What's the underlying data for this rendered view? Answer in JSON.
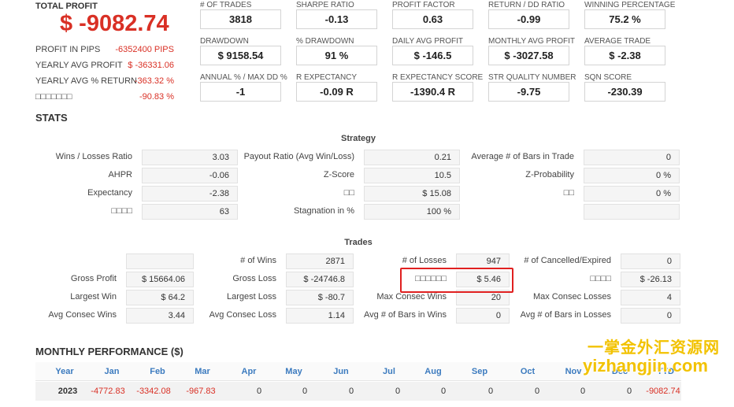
{
  "summary": {
    "total_profit_label": "TOTAL PROFIT",
    "total_profit_value": "$ -9082.74",
    "rows": [
      {
        "label": "PROFIT IN PIPS",
        "value": "-6352400 PIPS"
      },
      {
        "label": "YEARLY AVG PROFIT",
        "value": "$ -36331.06"
      },
      {
        "label": "YEARLY AVG % RETURN",
        "value": "-363.32 %"
      },
      {
        "label": "□□□□□□□",
        "value": "-90.83 %"
      }
    ]
  },
  "metrics": [
    {
      "label": "# OF TRADES",
      "value": "3818"
    },
    {
      "label": "SHARPE RATIO",
      "value": "-0.13"
    },
    {
      "label": "PROFIT FACTOR",
      "value": "0.63"
    },
    {
      "label": "RETURN / DD RATIO",
      "value": "-0.99"
    },
    {
      "label": "WINNING PERCENTAGE",
      "value": "75.2 %"
    },
    {
      "label": "DRAWDOWN",
      "value": "$ 9158.54"
    },
    {
      "label": "% DRAWDOWN",
      "value": "91 %"
    },
    {
      "label": "DAILY AVG PROFIT",
      "value": "$ -146.5"
    },
    {
      "label": "MONTHLY AVG PROFIT",
      "value": "$ -3027.58"
    },
    {
      "label": "AVERAGE TRADE",
      "value": "$ -2.38"
    },
    {
      "label": "ANNUAL % / MAX DD %",
      "value": "-1"
    },
    {
      "label": "R EXPECTANCY",
      "value": "-0.09 R"
    },
    {
      "label": "R EXPECTANCY SCORE",
      "value": "-1390.4 R"
    },
    {
      "label": "STR QUALITY NUMBER",
      "value": "-9.75"
    },
    {
      "label": "SQN SCORE",
      "value": "-230.39"
    }
  ],
  "stats_title": "STATS",
  "strategy": {
    "title": "Strategy",
    "rows": [
      [
        {
          "label": "Wins / Losses Ratio",
          "value": "3.03"
        },
        {
          "label": "Payout Ratio (Avg Win/Loss)",
          "value": "0.21"
        },
        {
          "label": "Average # of Bars in Trade",
          "value": "0"
        }
      ],
      [
        {
          "label": "AHPR",
          "value": "-0.06"
        },
        {
          "label": "Z-Score",
          "value": "10.5"
        },
        {
          "label": "Z-Probability",
          "value": "0 %"
        }
      ],
      [
        {
          "label": "Expectancy",
          "value": "-2.38"
        },
        {
          "label": "□□",
          "value": "$ 15.08"
        },
        {
          "label": "□□",
          "value": "0 %"
        }
      ],
      [
        {
          "label": "□□□□",
          "value": "63"
        },
        {
          "label": "Stagnation in %",
          "value": "100 %"
        },
        {
          "label": "",
          "value": ""
        }
      ]
    ]
  },
  "trades": {
    "title": "Trades",
    "rows": [
      [
        {
          "label": "",
          "value": ""
        },
        {
          "label": "# of Wins",
          "value": "2871"
        },
        {
          "label": "# of Losses",
          "value": "947"
        },
        {
          "label": "# of Cancelled/Expired",
          "value": "0"
        }
      ],
      [
        {
          "label": "Gross Profit",
          "value": "$ 15664.06"
        },
        {
          "label": "Gross Loss",
          "value": "$ -24746.8"
        },
        {
          "label": "□□□□□□",
          "value": "$ 5.46"
        },
        {
          "label": "□□□□",
          "value": "$ -26.13"
        }
      ],
      [
        {
          "label": "Largest Win",
          "value": "$ 64.2"
        },
        {
          "label": "Largest Loss",
          "value": "$ -80.7"
        },
        {
          "label": "Max Consec Wins",
          "value": "20"
        },
        {
          "label": "Max Consec Losses",
          "value": "4"
        }
      ],
      [
        {
          "label": "Avg Consec Wins",
          "value": "3.44"
        },
        {
          "label": "Avg Consec Loss",
          "value": "1.14"
        },
        {
          "label": "Avg # of Bars in Wins",
          "value": "0"
        },
        {
          "label": "Avg # of Bars in Losses",
          "value": "0"
        }
      ]
    ]
  },
  "monthly": {
    "title": "MONTHLY PERFORMANCE ($)",
    "headers": [
      "Year",
      "Jan",
      "Feb",
      "Mar",
      "Apr",
      "May",
      "Jun",
      "Jul",
      "Aug",
      "Sep",
      "Oct",
      "Nov",
      "Dec",
      "YTD"
    ],
    "rows": [
      {
        "year": "2023",
        "values": [
          "-4772.83",
          "-3342.08",
          "-967.83",
          "0",
          "0",
          "0",
          "0",
          "0",
          "0",
          "0",
          "0",
          "0",
          "-9082.74"
        ]
      }
    ]
  },
  "watermark": {
    "line1": "一掌金外汇资源网",
    "line2": "yizhangjin.com"
  },
  "colors": {
    "negative": "#d93025",
    "month_header": "#3c7bbf",
    "highlight": "#e02020",
    "watermark": "#f2c200"
  }
}
